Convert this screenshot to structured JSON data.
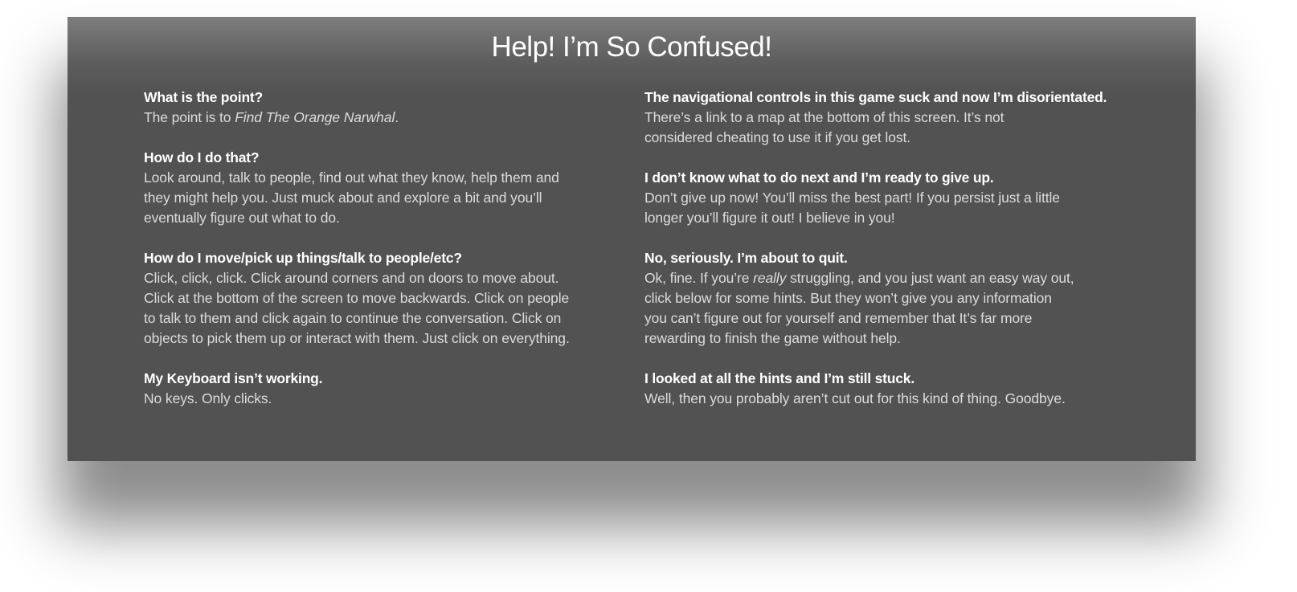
{
  "help": {
    "title": "Help! I’m So Confused!",
    "left": [
      {
        "question": "What is the point?",
        "answer_lines": [
          {
            "before": "The point is to ",
            "italic": "Find The Orange Narwhal",
            "after": "."
          }
        ]
      },
      {
        "question": "How do I do that?",
        "answer_lines": [
          {
            "text": "Look around, talk to people, find out what they know, help them and"
          },
          {
            "text": "they might help you. Just muck about and explore a bit and you’ll"
          },
          {
            "text": "eventually figure out what to do."
          }
        ]
      },
      {
        "question": "How do I move/pick up things/talk to people/etc?",
        "answer_lines": [
          {
            "text": "Click, click, click. Click around corners and on doors to move about."
          },
          {
            "text": "Click at the bottom of the screen to move backwards. Click on people"
          },
          {
            "text": "to talk to them and click again to continue the conversation. Click on"
          },
          {
            "text": "objects to pick them up or interact with them. Just click on everything."
          }
        ]
      },
      {
        "question": "My Keyboard isn’t working.",
        "answer_lines": [
          {
            "text": "No keys. Only clicks."
          }
        ]
      }
    ],
    "right": [
      {
        "question": "The navigational controls in this game suck and now I’m disorientated.",
        "answer_lines": [
          {
            "text": "There’s a link to a map at the bottom of this screen. It’s not"
          },
          {
            "text": "considered cheating to use it if you get lost."
          }
        ]
      },
      {
        "question": "I don’t know what to do next and I’m ready to give up.",
        "answer_lines": [
          {
            "text": "Don’t give up now! You’ll miss the best part! If you persist just a little"
          },
          {
            "text": "longer you’ll figure it out! I believe in you!"
          }
        ]
      },
      {
        "question": "No, seriously. I’m about to quit.",
        "answer_lines": [
          {
            "before": "Ok, fine. If you’re ",
            "italic": "really",
            "after": " struggling, and you just want an easy way out,"
          },
          {
            "text": "click below for some hints. But they won’t give you any information"
          },
          {
            "text": "you can’t figure out for yourself and remember that It’s far more"
          },
          {
            "text": "rewarding to finish the game without help."
          }
        ]
      },
      {
        "question": "I looked at all the hints and I’m still stuck.",
        "answer_lines": [
          {
            "text": "Well, then you probably aren’t cut out for this kind of thing. Goodbye."
          }
        ]
      }
    ]
  }
}
